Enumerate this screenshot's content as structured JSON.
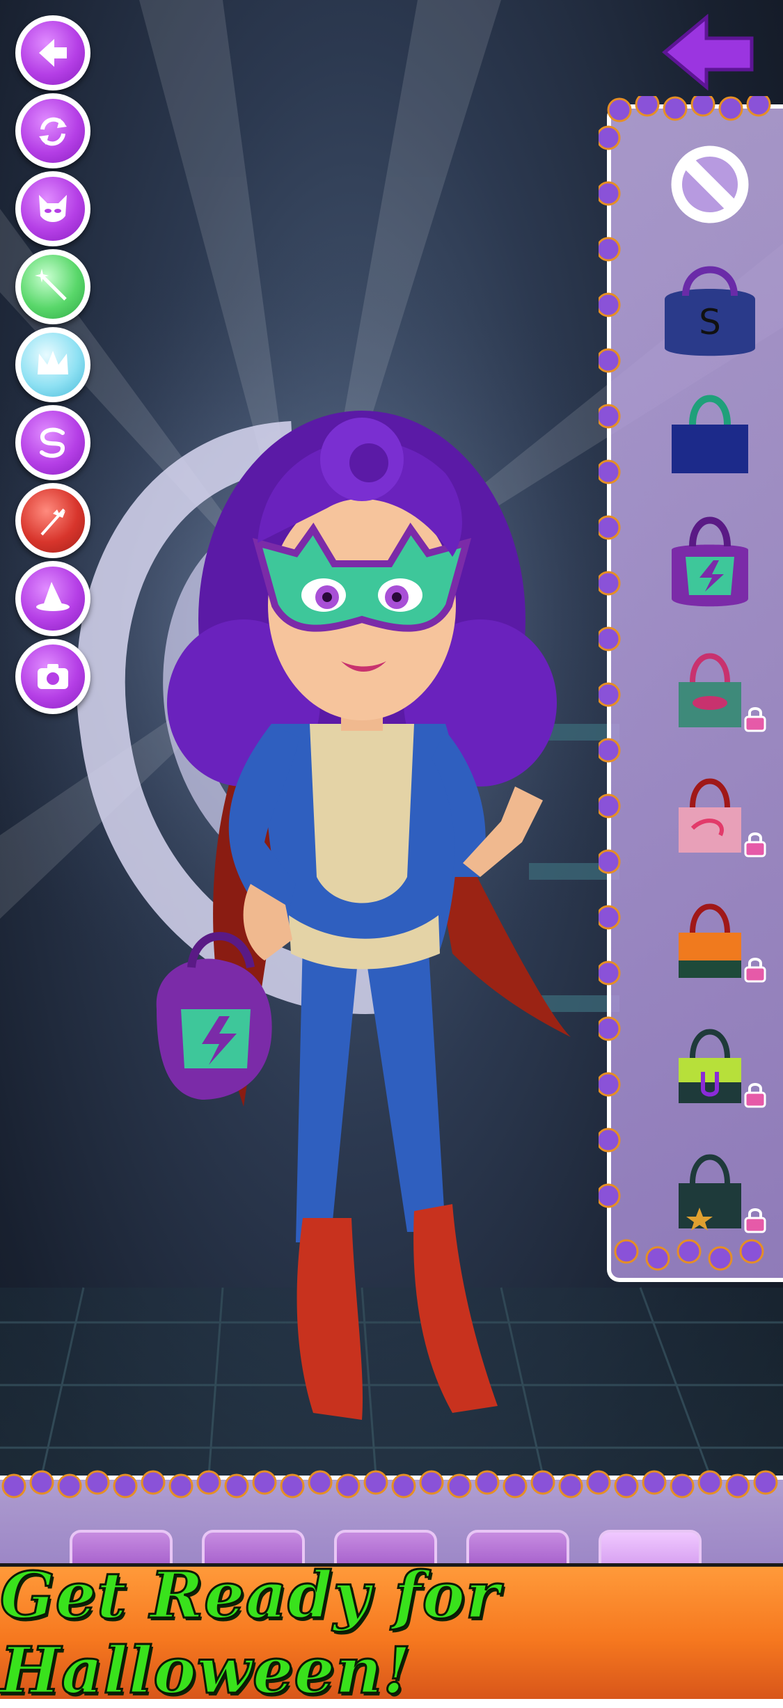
{
  "sidebar": {
    "buttons": [
      {
        "name": "back-icon",
        "style": "purple"
      },
      {
        "name": "refresh-icon",
        "style": "purple"
      },
      {
        "name": "cat-mask-icon",
        "style": "purple"
      },
      {
        "name": "magic-wand-icon",
        "style": "green"
      },
      {
        "name": "crown-icon",
        "style": "blue"
      },
      {
        "name": "hair-curl-icon",
        "style": "purple"
      },
      {
        "name": "bat-broom-icon",
        "style": "red"
      },
      {
        "name": "witch-hat-icon",
        "style": "purple"
      },
      {
        "name": "camera-icon",
        "style": "purple"
      }
    ]
  },
  "items_panel": {
    "items": [
      {
        "name": "none-icon",
        "locked": false
      },
      {
        "name": "bag-s-navy",
        "letter": "S",
        "locked": false
      },
      {
        "name": "bag-navy",
        "locked": false
      },
      {
        "name": "bag-lightning-purple",
        "locked": false
      },
      {
        "name": "bag-green-eye",
        "locked": true
      },
      {
        "name": "bag-pink-swirl",
        "locked": true
      },
      {
        "name": "bag-orange",
        "locked": true
      },
      {
        "name": "bag-lime-u",
        "locked": true
      },
      {
        "name": "bag-dark-star",
        "locked": true
      }
    ]
  },
  "banner": {
    "text": "Get Ready for Halloween!"
  },
  "colors": {
    "accent_purple": "#b53fe6",
    "banner_orange": "#f6781f",
    "banner_text_green": "#39e21c"
  }
}
